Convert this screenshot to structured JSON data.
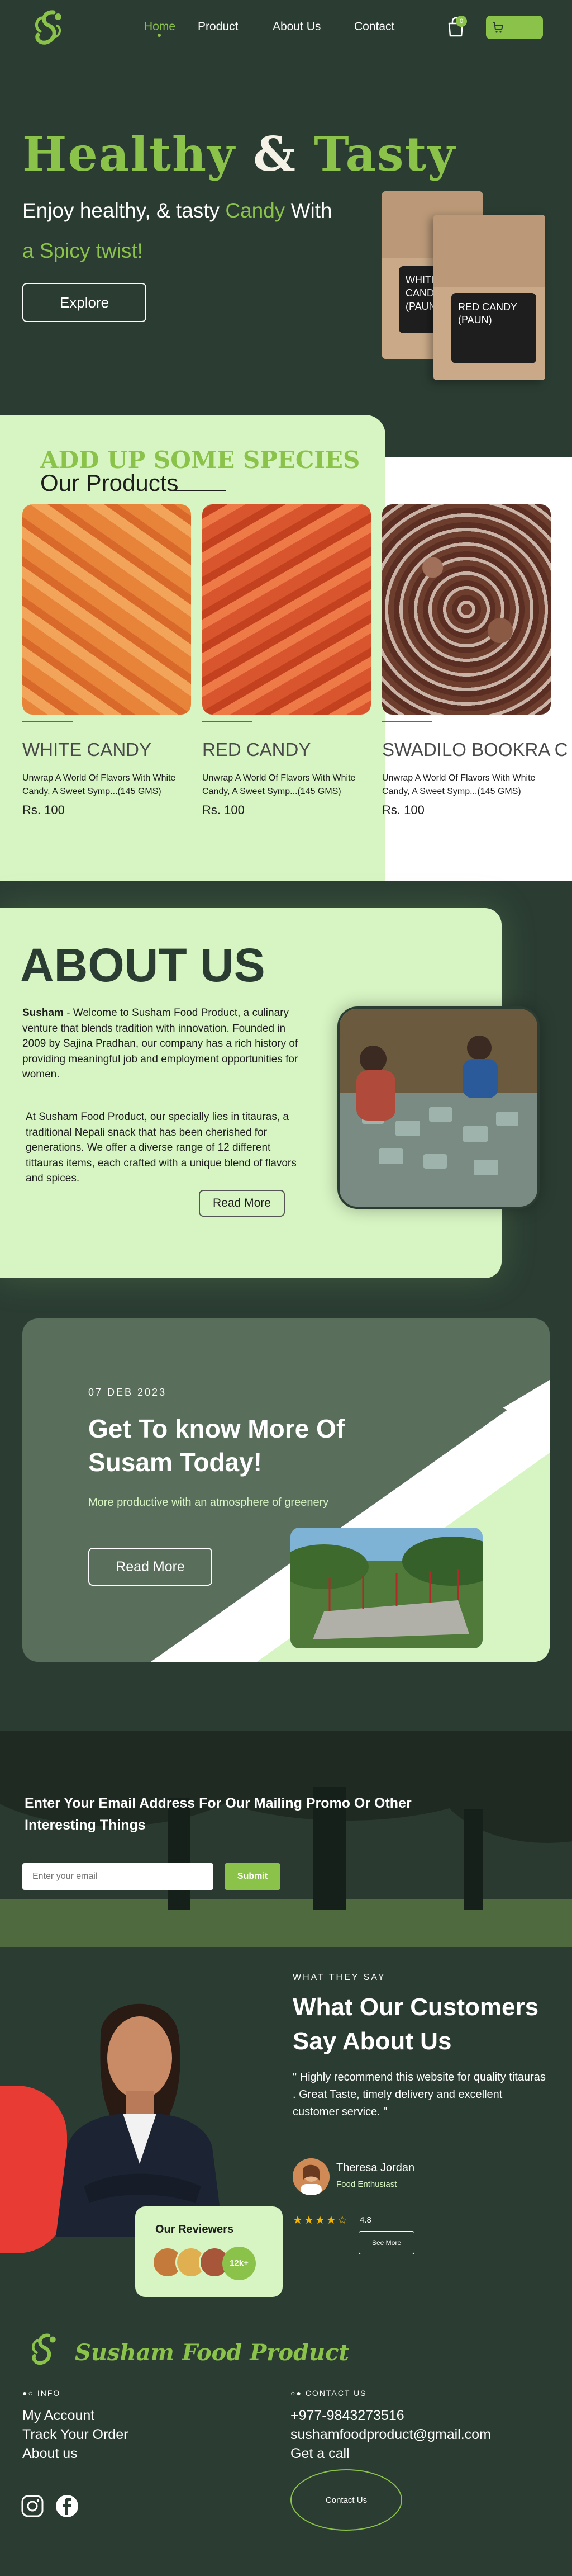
{
  "nav": {
    "links": [
      "Home",
      "Product",
      "About Us",
      "Contact"
    ],
    "cart_count": "0"
  },
  "hero": {
    "title_word1": "Healthy",
    "title_amp": "&",
    "title_word2": "Tasty",
    "subtitle_prefix": "Enjoy healthy, & tasty ",
    "subtitle_highlight": "Candy",
    "subtitle_suffix": " With",
    "subtitle_line2": "a Spicy twist!",
    "cta": "Explore",
    "bag_back_label": "WHITE CANDY (PAUN)",
    "bag_front_label": "RED CANDY (PAUN)"
  },
  "products": {
    "kicker": "ADD UP SOME SPECIES",
    "title": "Our Products",
    "items": [
      {
        "name": "WHITE CANDY",
        "desc": "Unwrap A World Of Flavors With White Candy, A Sweet Symp...(145 GMS)",
        "price": "Rs. 100"
      },
      {
        "name": "RED CANDY",
        "desc": "Unwrap A World Of Flavors With White Candy, A Sweet Symp...(145 GMS)",
        "price": "Rs. 100"
      },
      {
        "name": "SWADILO BOOKRA C",
        "desc": "Unwrap A World Of Flavors With White Candy, A Sweet Symp...(145 GMS)",
        "price": "Rs. 100"
      }
    ]
  },
  "about": {
    "title": "ABOUT US",
    "brand": "Susham",
    "p1": " - Welcome to Susham Food Product, a culinary venture that blends tradition with innovation. Founded in 2009 by Sajina Pradhan, our company has a rich history of providing meaningful job and employment opportunities for women.",
    "p2": "At Susham Food Product, our specially lies in titauras, a traditional Nepali snack that has been cherished for generations. We offer a diverse range of 12 different tittauras items, each crafted with a unique blend of flavors and spices.",
    "cta": "Read More"
  },
  "know": {
    "date": "07 DEB 2023",
    "title": "Get To know More Of Susam Today!",
    "subtitle": "More productive with an atmosphere of greenery",
    "cta": "Read More"
  },
  "newsletter": {
    "title": "Enter Your Email Address For Our Mailing Promo Or Other Interesting Things",
    "placeholder": "Enter your email",
    "submit": "Submit"
  },
  "testimonials": {
    "kicker": "WHAT THEY SAY",
    "title": "What Our Customers Say About Us",
    "quote": "\" Highly recommend this website for quality titauras . Great Taste, timely delivery and excellent customer service. \"",
    "name": "Theresa Jordan",
    "role": "Food Enthusiast",
    "rating": 4.8,
    "rating_text": "4.8",
    "cta": "See More",
    "reviewers_title": "Our Reviewers",
    "reviewers_count": "12k+"
  },
  "footer": {
    "brand": "Susham Food Product",
    "info_kicker": "INFO",
    "info_links": [
      "My Account",
      "Track Your Order",
      "About us"
    ],
    "contact_kicker": "CONTACT US",
    "phone": "+977-9843273516",
    "email": "sushamfoodproduct@gmail.com",
    "call": "Get a call",
    "contact_cta": "Contact Us"
  },
  "colors": {
    "background": "#2b3d33",
    "accent": "#8bc34a",
    "mint": "#d7f5c3",
    "star": "#f5b400",
    "red": "#e83b33"
  }
}
